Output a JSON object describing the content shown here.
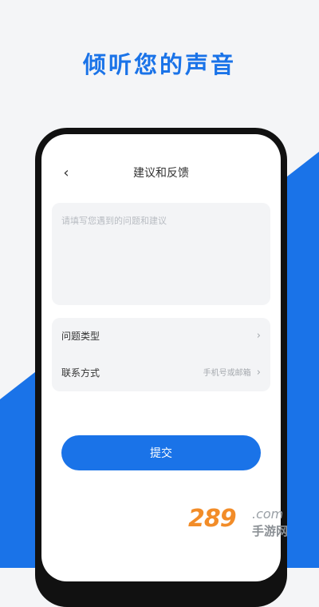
{
  "promo": {
    "title": "倾听您的声音"
  },
  "nav": {
    "back_icon": "‹",
    "title": "建议和反馈"
  },
  "feedback": {
    "placeholder": "请填写您遇到的问题和建议"
  },
  "options": [
    {
      "label": "问题类型",
      "value": ""
    },
    {
      "label": "联系方式",
      "value": "手机号或邮箱"
    }
  ],
  "chevron": "›",
  "submit": {
    "label": "提交"
  },
  "watermark": {
    "number": "289",
    "dotcom": ".com",
    "cn": "手游网"
  },
  "colors": {
    "accent": "#1a73e8",
    "card": "#f3f4f6",
    "watermark": "#f28c28"
  }
}
